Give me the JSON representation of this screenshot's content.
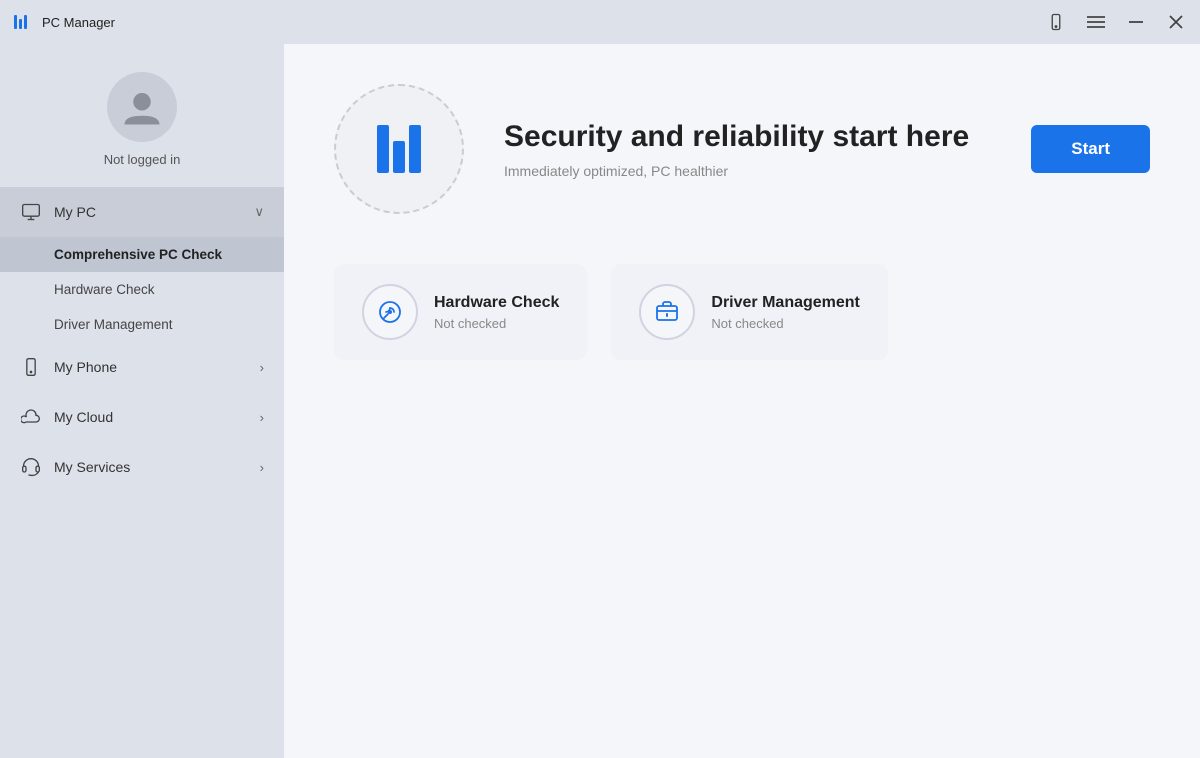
{
  "titleBar": {
    "appName": "PC Manager",
    "controls": {
      "phone": "📱",
      "menu": "☰",
      "minimize": "—",
      "close": "✕"
    }
  },
  "sidebar": {
    "user": {
      "status": "Not logged in"
    },
    "navItems": [
      {
        "id": "my-pc",
        "label": "My PC",
        "chevron": "∨",
        "expanded": true
      },
      {
        "id": "my-phone",
        "label": "My Phone",
        "chevron": "›"
      },
      {
        "id": "my-cloud",
        "label": "My Cloud",
        "chevron": "›"
      },
      {
        "id": "my-services",
        "label": "My Services",
        "chevron": "›"
      }
    ],
    "subNavItems": [
      {
        "id": "comprehensive-pc-check",
        "label": "Comprehensive PC Check",
        "active": true
      },
      {
        "id": "hardware-check",
        "label": "Hardware Check",
        "active": false
      },
      {
        "id": "driver-management",
        "label": "Driver Management",
        "active": false
      }
    ]
  },
  "main": {
    "hero": {
      "title": "Security and reliability start here",
      "subtitle": "Immediately optimized, PC healthier",
      "startButton": "Start"
    },
    "cards": [
      {
        "id": "hardware-check",
        "title": "Hardware Check",
        "status": "Not checked"
      },
      {
        "id": "driver-management",
        "title": "Driver Management",
        "status": "Not checked"
      }
    ]
  }
}
